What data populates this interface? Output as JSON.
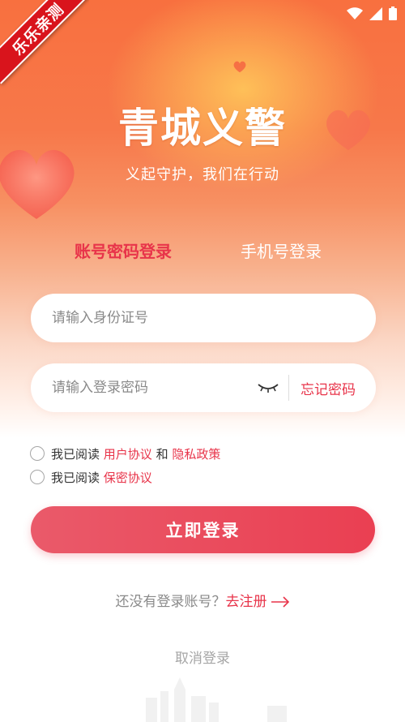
{
  "corner_ribbon": "乐乐亲测",
  "app": {
    "logo": "青城义警",
    "slogan": "义起守护，我们在行动"
  },
  "tabs": {
    "account_login": "账号密码登录",
    "phone_login": "手机号登录"
  },
  "form": {
    "id_placeholder": "请输入身份证号",
    "password_placeholder": "请输入登录密码",
    "forgot_password": "忘记密码"
  },
  "agreements": {
    "read_prefix_1": "我已阅读",
    "user_agreement": "用户协议",
    "and": "和",
    "privacy_policy": "隐私政策",
    "read_prefix_2": "我已阅读",
    "confidentiality_agreement": "保密协议"
  },
  "actions": {
    "login_button": "立即登录",
    "no_account_text": "还没有登录账号？",
    "register_link": "去注册",
    "cancel_login": "取消登录"
  },
  "colors": {
    "accent": "#e8344a",
    "header_orange": "#f8703f"
  },
  "icons": [
    "wifi-icon",
    "signal-icon",
    "battery-icon",
    "eye-closed-icon",
    "arrow-right-icon"
  ]
}
